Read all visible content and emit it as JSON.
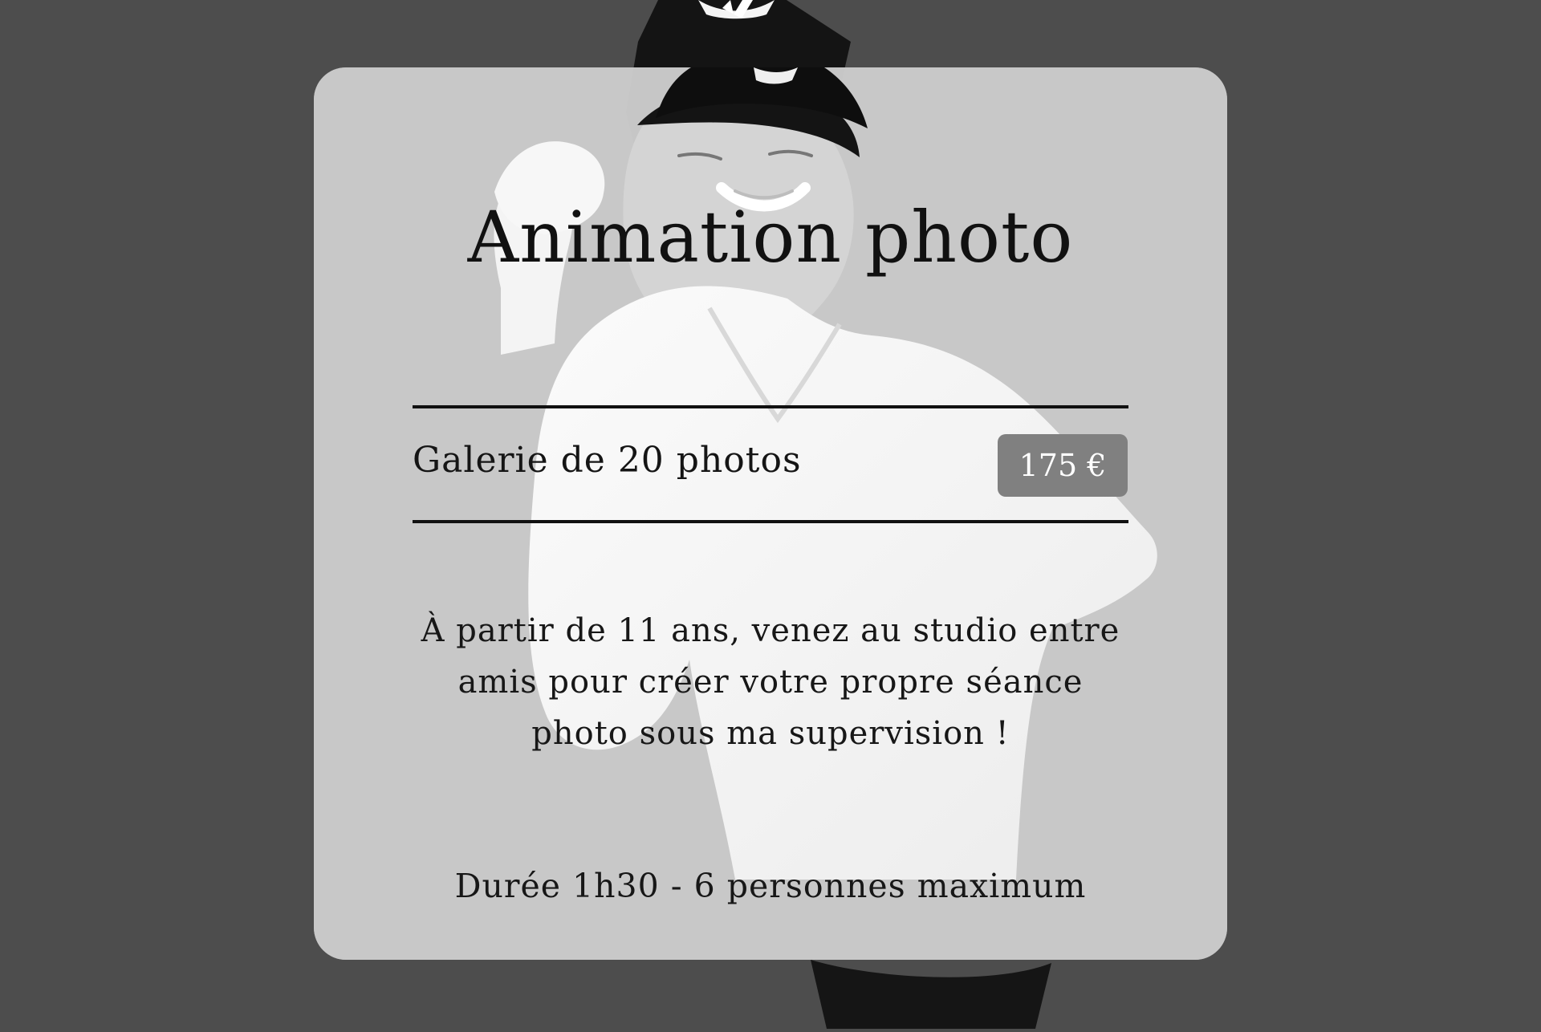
{
  "card": {
    "title": "Animation photo",
    "package": {
      "label": "Galerie de 20 photos",
      "price": "175 €"
    },
    "description_lines": [
      "À partir de 11 ans, venez au studio entre",
      "amis pour créer votre propre séance",
      "photo sous ma supervision !"
    ],
    "details": "Durée 1h30 - 6 personnes maximum"
  },
  "colors": {
    "page_background": "#4d4d4d",
    "card_background": "#dedede",
    "price_badge": "#808080",
    "text": "#111111"
  },
  "visual": {
    "background_subject": "person-photo",
    "card_style": "rounded-translucent-panel"
  }
}
